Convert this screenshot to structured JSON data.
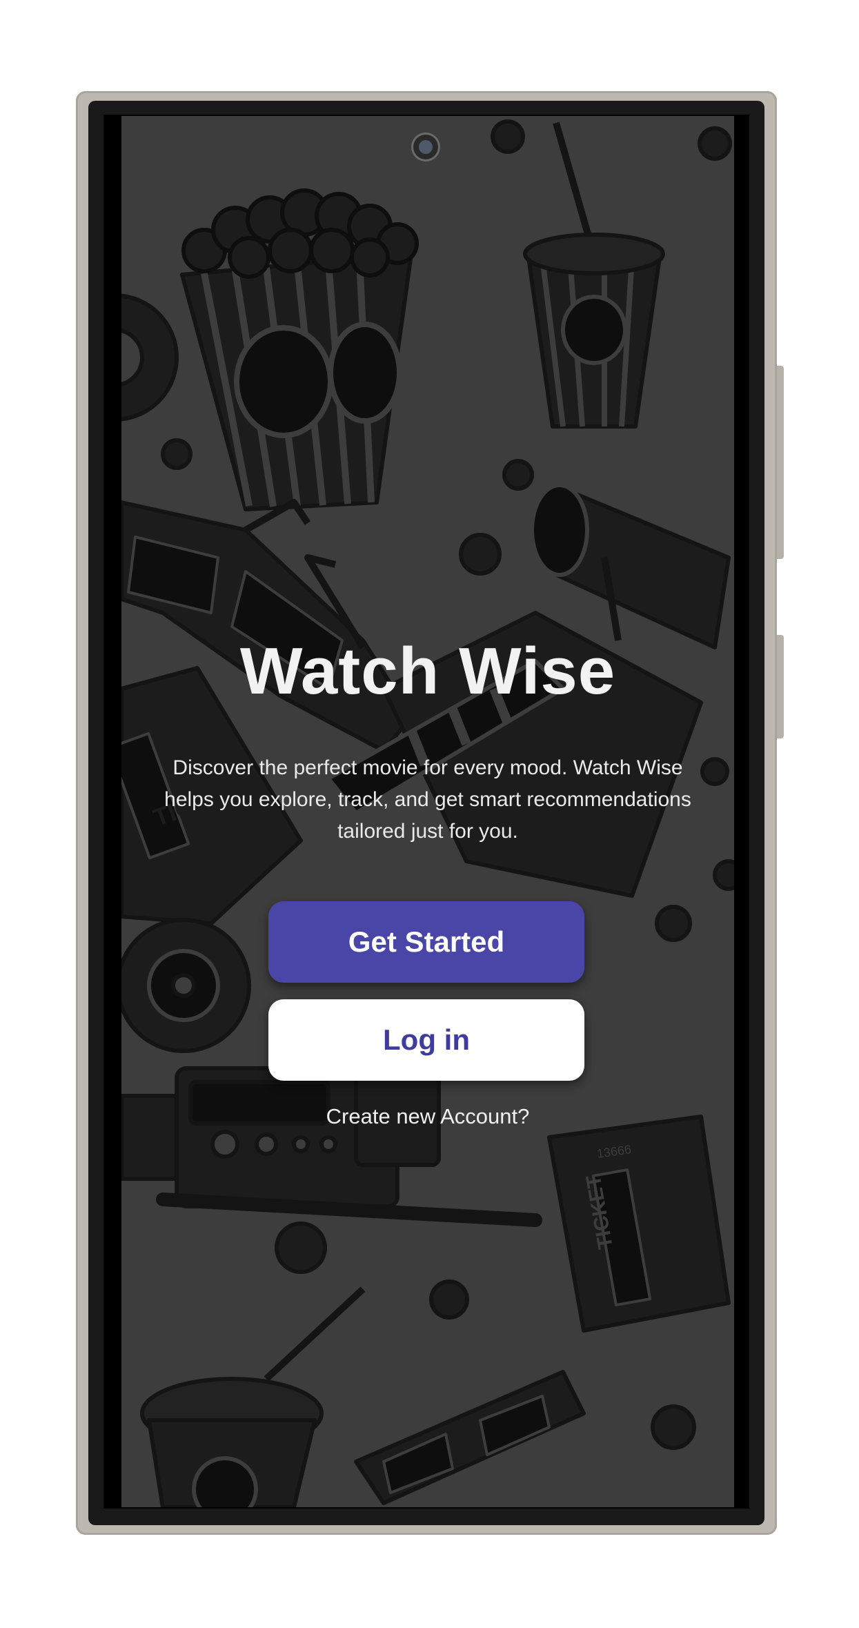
{
  "app": {
    "title": "Watch Wise",
    "description": "Discover the perfect movie for every mood. Watch Wise helps you explore, track, and get smart recommendations tailored just for you."
  },
  "actions": {
    "get_started_label": "Get Started",
    "login_label": "Log in",
    "create_account_label": "Create new Account?"
  },
  "decor": {
    "ticket_text": "TICKET",
    "ticket_number": "13666"
  },
  "colors": {
    "primary_button": "#4a46a8",
    "login_text": "#403c9e",
    "screen_background": "#3d3d3d"
  }
}
